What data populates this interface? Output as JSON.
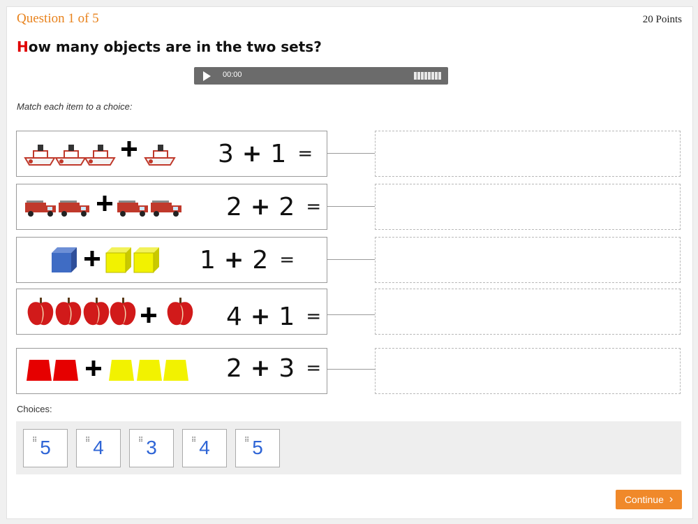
{
  "header": {
    "question_counter": "Question 1 of 5",
    "points": "20 Points",
    "title_first_letter": "H",
    "title_rest": "ow many objects are in the two sets?"
  },
  "audio": {
    "time": "00:00",
    "play_icon": "play-icon",
    "volume_icon": "volume-bars-icon"
  },
  "instruction": "Match each item to a choice:",
  "items": [
    {
      "left": "3",
      "right": "1",
      "equals": "=",
      "object": "boat"
    },
    {
      "left": "2",
      "right": "2",
      "equals": "=",
      "object": "fire-truck"
    },
    {
      "left": "1",
      "right": "2",
      "equals": "=",
      "object": "cube"
    },
    {
      "left": "4",
      "right": "1",
      "equals": "=",
      "object": "apple"
    },
    {
      "left": "2",
      "right": "3",
      "equals": "=",
      "object": "trapezoid"
    }
  ],
  "choices_label": "Choices:",
  "choices": [
    "5",
    "4",
    "3",
    "4",
    "5"
  ],
  "continue_label": "Continue",
  "colors": {
    "accent": "#f0892a",
    "title_highlight": "#e00000",
    "choice_text": "#2f65d6"
  }
}
